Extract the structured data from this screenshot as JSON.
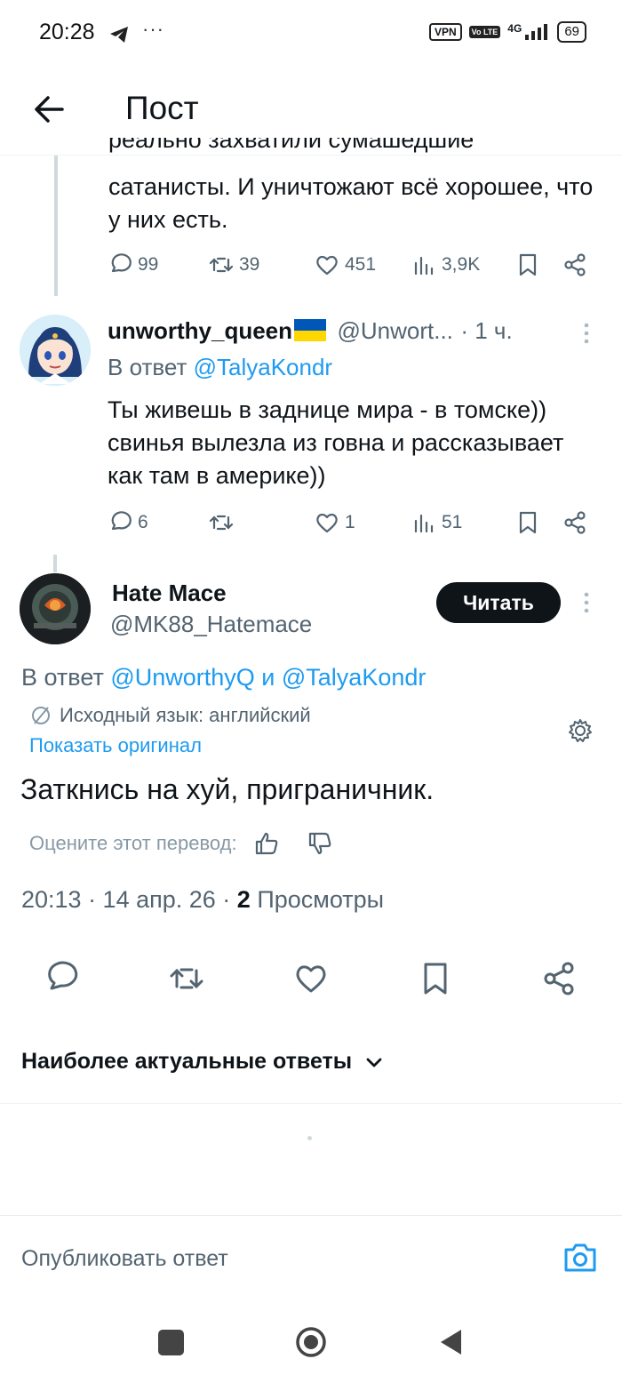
{
  "status_bar": {
    "time": "20:28",
    "dots": "···",
    "vpn": "VPN",
    "volte": "Vo LTE",
    "network": "4G",
    "battery": "69"
  },
  "header": {
    "title": "Пост"
  },
  "prev_post": {
    "text_cut": "реально захватили сумашедшие",
    "text": "сатанисты. И уничтожают всё хорошее, что у них есть.",
    "actions": {
      "replies": "99",
      "reposts": "39",
      "likes": "451",
      "views": "3,9K"
    }
  },
  "reply1": {
    "name": "unworthy_queen",
    "flag": "🇺🇦",
    "handle": "@Unwort...",
    "time": "· 1 ч.",
    "reply_to_prefix": "В ответ ",
    "reply_to": "@TalyaKondr",
    "text": "Ты живешь в заднице мира - в томске)) свинья вылезла из говна и рассказывает как там в америке))",
    "actions": {
      "replies": "6",
      "reposts": "",
      "likes": "1",
      "views": "51"
    }
  },
  "main_post": {
    "name": "Hate Mace",
    "handle": "@MK88_Hatemace",
    "follow_label": "Читать",
    "reply_to_prefix": "В ответ ",
    "reply_to_1": "@UnworthyQ",
    "reply_to_and": " и ",
    "reply_to_2": "@TalyaKondr",
    "translation_note": "Исходный язык: английский",
    "show_original": "Показать оригинал",
    "text": "Заткнись на хуй, приграничник.",
    "rate_prompt": "Оцените этот перевод:",
    "timestamp": "20:13 · 14 апр. 26 · ",
    "views_count": "2",
    "views_label": " Просмотры"
  },
  "replies_sort": {
    "label": "Наиболее актуальные ответы"
  },
  "reply_bar": {
    "placeholder": "Опубликовать ответ"
  },
  "colors": {
    "accent": "#1d9bf0",
    "text": "#0f1419",
    "muted": "#536471",
    "ukraine_blue": "#0057b7",
    "ukraine_yellow": "#ffd700"
  }
}
